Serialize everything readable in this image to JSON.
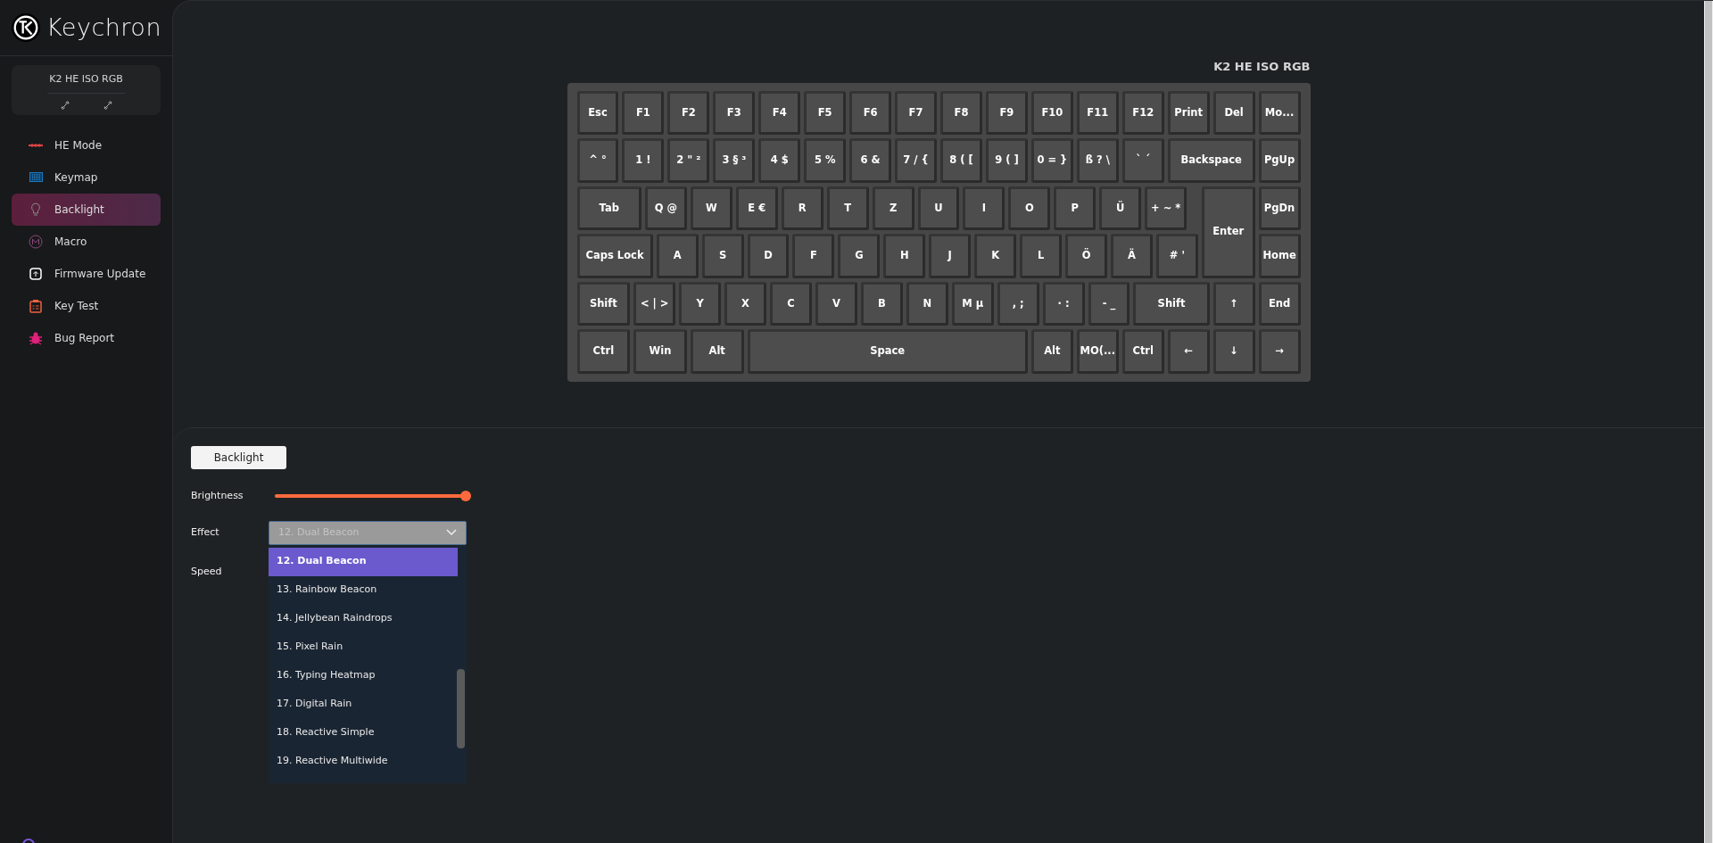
{
  "brand": {
    "name": "Keychron"
  },
  "device": {
    "name": "K2 HE ISO RGB"
  },
  "sidebar": {
    "items": [
      {
        "label": "HE Mode",
        "selected": false
      },
      {
        "label": "Keymap",
        "selected": false
      },
      {
        "label": "Backlight",
        "selected": true
      },
      {
        "label": "Macro",
        "selected": false
      },
      {
        "label": "Firmware Update",
        "selected": false
      },
      {
        "label": "Key Test",
        "selected": false
      },
      {
        "label": "Bug Report",
        "selected": false
      }
    ]
  },
  "keyboard": {
    "title": "K2 HE ISO RGB",
    "key_rows": [
      [
        "Esc",
        "F1",
        "F2",
        "F3",
        "F4",
        "F5",
        "F6",
        "F7",
        "F8",
        "F9",
        "F10",
        "F11",
        "F12",
        "Print",
        "Del",
        "Mo..."
      ],
      [
        "^ °",
        "1 !",
        "2 \" ²",
        "3 § ³",
        "4 $",
        "5 %",
        "6 &",
        "7 / {",
        "8 ( [",
        "9 ( ]",
        "0 = }",
        "ß ? \\",
        "` ´",
        "Backspace",
        "PgUp"
      ],
      [
        "Tab",
        "Q @",
        "W",
        "E €",
        "R",
        "T",
        "Z",
        "U",
        "I",
        "O",
        "P",
        "Ü",
        "+ ~ *",
        "Enter",
        "PgDn"
      ],
      [
        "Caps Lock",
        "A",
        "S",
        "D",
        "F",
        "G",
        "H",
        "J",
        "K",
        "L",
        "Ö",
        "Ä",
        "# '",
        "Home"
      ],
      [
        "Shift",
        "< | >",
        "Y",
        "X",
        "C",
        "V",
        "B",
        "N",
        "M µ",
        ", ;",
        "· :",
        "- _",
        "Shift",
        "↑",
        "End"
      ],
      [
        "Ctrl",
        "Win",
        "Alt",
        "Space",
        "Alt",
        "MO(...",
        "Ctrl",
        "←",
        "↓",
        "→"
      ]
    ]
  },
  "panel": {
    "tab": "Backlight",
    "brightness": {
      "label": "Brightness",
      "level": 1
    },
    "effect": {
      "label": "Effect",
      "value": "12. Dual Beacon",
      "expanded": true,
      "options": [
        {
          "label": "12. Dual Beacon",
          "selected": true
        },
        {
          "label": "13. Rainbow Beacon",
          "selected": false
        },
        {
          "label": "14. Jellybean Raindrops",
          "selected": false
        },
        {
          "label": "15. Pixel Rain",
          "selected": false
        },
        {
          "label": "16. Typing Heatmap",
          "selected": false
        },
        {
          "label": "17. Digital Rain",
          "selected": false
        },
        {
          "label": "18. Reactive Simple",
          "selected": false
        },
        {
          "label": "19. Reactive Multiwide",
          "selected": false
        }
      ]
    },
    "speed": {
      "label": "Speed"
    }
  }
}
